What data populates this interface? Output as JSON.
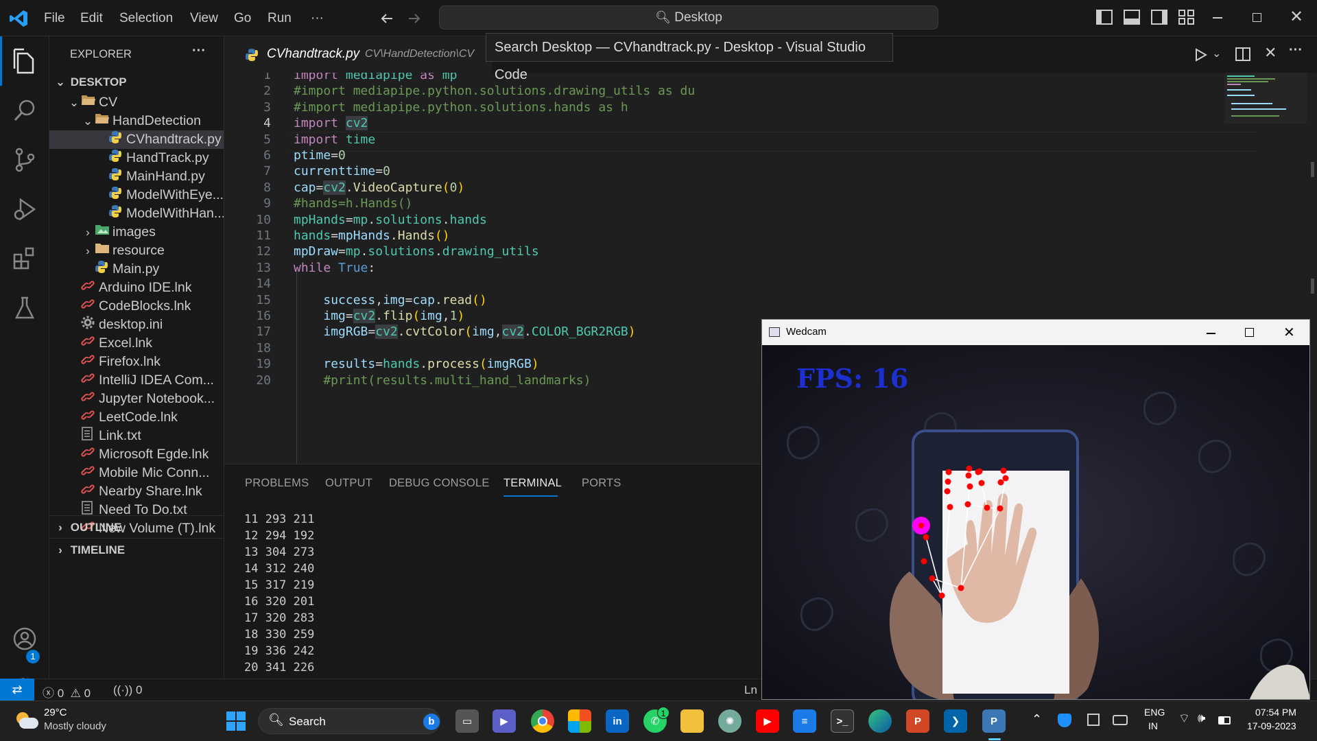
{
  "menu": [
    "File",
    "Edit",
    "Selection",
    "View",
    "Go",
    "Run",
    "···"
  ],
  "command_center": "Desktop",
  "tooltip": "Search Desktop — CVhandtrack.py - Desktop - Visual Studio Code",
  "explorer": {
    "title": "EXPLORER",
    "more": "···",
    "root": "DESKTOP",
    "items": [
      {
        "label": "CV",
        "type": "folder-open",
        "depth": 1
      },
      {
        "label": "HandDetection",
        "type": "folder-open",
        "depth": 2
      },
      {
        "label": "CVhandtrack.py",
        "type": "py",
        "depth": 3,
        "selected": true
      },
      {
        "label": "HandTrack.py",
        "type": "py",
        "depth": 3
      },
      {
        "label": "MainHand.py",
        "type": "py",
        "depth": 3
      },
      {
        "label": "ModelWithEye....",
        "type": "py",
        "depth": 3
      },
      {
        "label": "ModelWithHan...",
        "type": "py",
        "depth": 3
      },
      {
        "label": "images",
        "type": "folder-img",
        "depth": 2
      },
      {
        "label": "resource",
        "type": "folder",
        "depth": 2
      },
      {
        "label": "Main.py",
        "type": "py",
        "depth": 2
      },
      {
        "label": "Arduino IDE.lnk",
        "type": "lnk",
        "depth": 1
      },
      {
        "label": "CodeBlocks.lnk",
        "type": "lnk",
        "depth": 1
      },
      {
        "label": "desktop.ini",
        "type": "ini",
        "depth": 1
      },
      {
        "label": "Excel.lnk",
        "type": "lnk",
        "depth": 1
      },
      {
        "label": "Firefox.lnk",
        "type": "lnk",
        "depth": 1
      },
      {
        "label": "IntelliJ IDEA Com...",
        "type": "lnk",
        "depth": 1
      },
      {
        "label": "Jupyter Notebook...",
        "type": "lnk",
        "depth": 1
      },
      {
        "label": "LeetCode.lnk",
        "type": "lnk",
        "depth": 1
      },
      {
        "label": "Link.txt",
        "type": "txt",
        "depth": 1
      },
      {
        "label": "Microsoft Egde.lnk",
        "type": "lnk",
        "depth": 1
      },
      {
        "label": "Mobile Mic Conn...",
        "type": "lnk",
        "depth": 1
      },
      {
        "label": "Nearby Share.lnk",
        "type": "lnk",
        "depth": 1
      },
      {
        "label": "Need To Do.txt",
        "type": "txt",
        "depth": 1
      },
      {
        "label": "New Volume (T).lnk",
        "type": "lnk",
        "depth": 1
      }
    ],
    "outline": "OUTLINE",
    "timeline": "TIMELINE"
  },
  "tab": {
    "filename": "CVhandtrack.py",
    "path": "CV\\HandDetection\\CV"
  },
  "code_lines": [
    "import mediapipe as mp",
    "#import mediapipe.python.solutions.drawing_utils as du",
    "#import mediapipe.python.solutions.hands as h",
    "import cv2",
    "import time",
    "ptime=0",
    "currenttime=0",
    "cap=cv2.VideoCapture(0)",
    "#hands=h.Hands()",
    "mpHands=mp.solutions.hands",
    "hands=mpHands.Hands()",
    "mpDraw=mp.solutions.drawing_utils",
    "while True:",
    "",
    "    success,img=cap.read()",
    "    img=cv2.flip(img,1)",
    "    imgRGB=cv2.cvtColor(img,cv2.COLOR_BGR2RGB)",
    "",
    "    results=hands.process(imgRGB)",
    "    #print(results.multi_hand_landmarks)"
  ],
  "line_numbers": [
    "1",
    "2",
    "3",
    "4",
    "5",
    "6",
    "7",
    "8",
    "9",
    "10",
    "11",
    "12",
    "13",
    "14",
    "15",
    "16",
    "17",
    "18",
    "19",
    "20"
  ],
  "current_line": "4",
  "panel": {
    "tabs": [
      "PROBLEMS",
      "OUTPUT",
      "DEBUG CONSOLE",
      "TERMINAL",
      "PORTS"
    ],
    "active": "TERMINAL",
    "terminal_lines": [
      "11 293 211",
      "12 294 192",
      "13 304 273",
      "14 312 240",
      "15 317 219",
      "16 320 201",
      "17 320 283",
      "18 330 259",
      "19 336 242",
      "20 341 226"
    ]
  },
  "status": {
    "errors": "0",
    "warnings": "0",
    "ports": "0",
    "ln": "Ln"
  },
  "settings_badge": "1",
  "wedcam": {
    "title": "Wedcam",
    "fps": "FPS: 16"
  },
  "taskbar": {
    "temp": "29°C",
    "weather": "Mostly cloudy",
    "search": "Search",
    "lang1": "ENG",
    "lang2": "IN",
    "time": "07:54 PM",
    "date": "17-09-2023",
    "whatsapp_badge": "1"
  },
  "colors": {
    "accent": "#0078d4",
    "fps": "#1e2fd0",
    "landmark": "#ff0000",
    "wrist": "#ff00ff"
  }
}
